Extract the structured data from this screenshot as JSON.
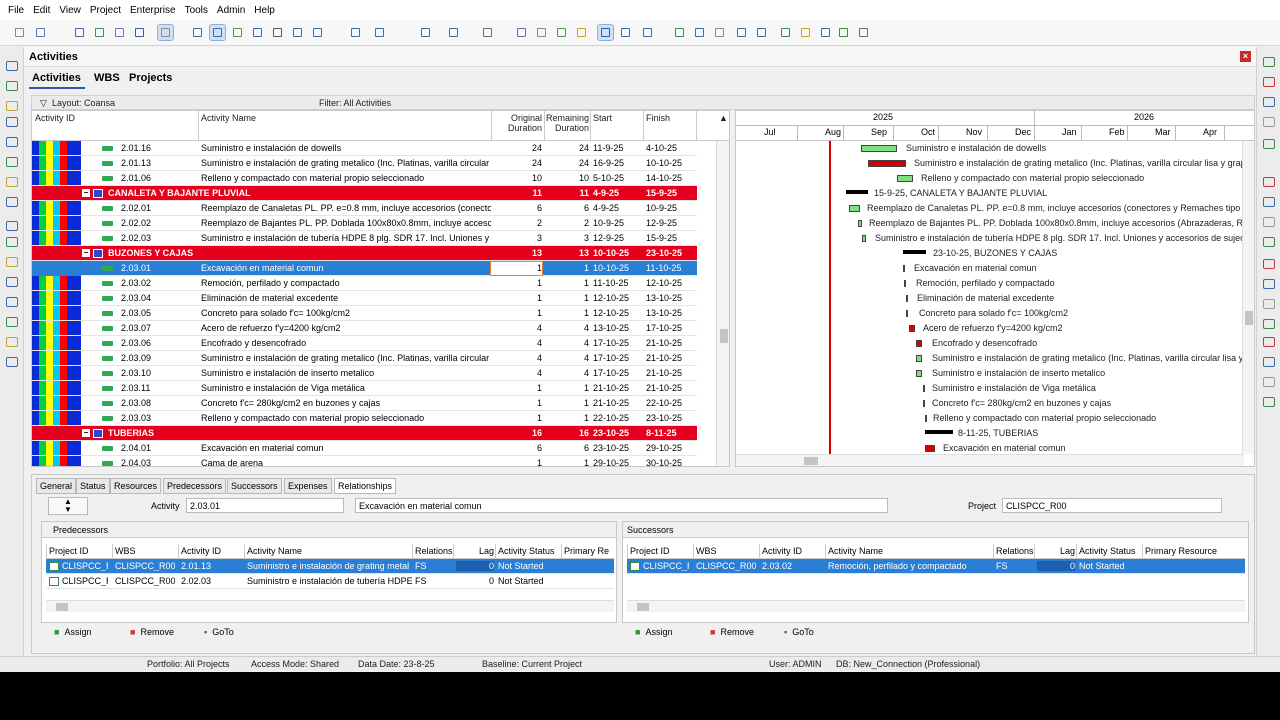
{
  "menu": [
    "File",
    "Edit",
    "View",
    "Project",
    "Enterprise",
    "Tools",
    "Admin",
    "Help"
  ],
  "panel_title": "Activities",
  "tabs": [
    "Activities",
    "WBS",
    "Projects"
  ],
  "layout_label": "Layout: Coansa",
  "filter_label": "Filter: All Activities",
  "grid": {
    "columns": {
      "id": "Activity ID",
      "name": "Activity Name",
      "od": "Original\nDuration",
      "rd": "Remaining\nDuration",
      "start": "Start",
      "finish": "Finish"
    },
    "rows": [
      {
        "type": "act",
        "id": "2.01.16",
        "name": "Suministro e instalación de dowells",
        "od": "24",
        "rd": "24",
        "start": "11-9-25",
        "finish": "4-10-25"
      },
      {
        "type": "act",
        "id": "2.01.13",
        "name": "Suministro e instalación de grating metalico (Inc. Platinas, varilla circular li",
        "od": "24",
        "rd": "24",
        "start": "16-9-25",
        "finish": "10-10-25"
      },
      {
        "type": "act",
        "id": "2.01.06",
        "name": "Relleno y compactado con material propio seleccionado",
        "od": "10",
        "rd": "10",
        "start": "5-10-25",
        "finish": "14-10-25"
      },
      {
        "type": "wbs",
        "id": "CANALETA Y BAJANTE PLUVIAL",
        "name": "",
        "od": "11",
        "rd": "11",
        "start": "4-9-25",
        "finish": "15-9-25"
      },
      {
        "type": "act",
        "id": "2.02.01",
        "name": "Reemplazo de Canaletas PL. PP. e=0.8 mm, incluye accesorios (conector",
        "od": "6",
        "rd": "6",
        "start": "4-9-25",
        "finish": "10-9-25"
      },
      {
        "type": "act",
        "id": "2.02.02",
        "name": "Reemplazo de Bajantes PL. PP. Doblada 100x80x0.8mm, incluye accesc",
        "od": "2",
        "rd": "2",
        "start": "10-9-25",
        "finish": "12-9-25"
      },
      {
        "type": "act",
        "id": "2.02.03",
        "name": "Suministro e instalación de tubería HDPE 8 plg. SDR 17. Incl. Uniones y",
        "od": "3",
        "rd": "3",
        "start": "12-9-25",
        "finish": "15-9-25"
      },
      {
        "type": "wbs",
        "id": "BUZONES Y CAJAS",
        "name": "",
        "od": "13",
        "rd": "13",
        "start": "10-10-25",
        "finish": "23-10-25"
      },
      {
        "type": "sel",
        "id": "2.03.01",
        "name": "Excavación en material comun",
        "od": "1",
        "rd": "1",
        "start": "10-10-25",
        "finish": "11-10-25"
      },
      {
        "type": "act",
        "id": "2.03.02",
        "name": "Remoción, perfilado y compactado",
        "od": "1",
        "rd": "1",
        "start": "11-10-25",
        "finish": "12-10-25"
      },
      {
        "type": "act",
        "id": "2.03.04",
        "name": "Eliminación de material excedente",
        "od": "1",
        "rd": "1",
        "start": "12-10-25",
        "finish": "13-10-25"
      },
      {
        "type": "act",
        "id": "2.03.05",
        "name": "Concreto para solado f'c= 100kg/cm2",
        "od": "1",
        "rd": "1",
        "start": "12-10-25",
        "finish": "13-10-25"
      },
      {
        "type": "act",
        "id": "2.03.07",
        "name": "Acero de refuerzo f'y=4200 kg/cm2",
        "od": "4",
        "rd": "4",
        "start": "13-10-25",
        "finish": "17-10-25"
      },
      {
        "type": "act",
        "id": "2.03.06",
        "name": "Encofrado y desencofrado",
        "od": "4",
        "rd": "4",
        "start": "17-10-25",
        "finish": "21-10-25"
      },
      {
        "type": "act",
        "id": "2.03.09",
        "name": "Suministro e instalación de grating metalico (Inc. Platinas, varilla circular li",
        "od": "4",
        "rd": "4",
        "start": "17-10-25",
        "finish": "21-10-25"
      },
      {
        "type": "act",
        "id": "2.03.10",
        "name": "Suministro e instalación de inserto metalico",
        "od": "4",
        "rd": "4",
        "start": "17-10-25",
        "finish": "21-10-25"
      },
      {
        "type": "act",
        "id": "2.03.11",
        "name": "Suministro e instalación de Viga metálica",
        "od": "1",
        "rd": "1",
        "start": "21-10-25",
        "finish": "21-10-25"
      },
      {
        "type": "act",
        "id": "2.03.08",
        "name": "Concreto f'c= 280kg/cm2 en buzones y cajas",
        "od": "1",
        "rd": "1",
        "start": "21-10-25",
        "finish": "22-10-25"
      },
      {
        "type": "act",
        "id": "2.03.03",
        "name": "Relleno y compactado con material propio seleccionado",
        "od": "1",
        "rd": "1",
        "start": "22-10-25",
        "finish": "23-10-25"
      },
      {
        "type": "wbs",
        "id": "TUBERIAS",
        "name": "",
        "od": "16",
        "rd": "16",
        "start": "23-10-25",
        "finish": "8-11-25"
      },
      {
        "type": "act",
        "id": "2.04.01",
        "name": "Excavación en material comun",
        "od": "6",
        "rd": "6",
        "start": "23-10-25",
        "finish": "29-10-25"
      },
      {
        "type": "act",
        "id": "2.04.03",
        "name": "Cama de arena",
        "od": "1",
        "rd": "1",
        "start": "29-10-25",
        "finish": "30-10-25"
      }
    ]
  },
  "gantt": {
    "years": [
      "2025",
      "2026"
    ],
    "months": [
      "Jul",
      "Aug",
      "Sep",
      "Oct",
      "Nov",
      "Dec",
      "Jan",
      "Feb",
      "Mar",
      "Apr"
    ],
    "labels": [
      "Suministro e instalación de dowells",
      "Suministro e instalación de grating metalico (Inc. Platinas, varilla circular lisa y grapa",
      "Relleno y compactado con material propio seleccionado",
      "15-9-25, CANALETA Y BAJANTE PLUVIAL",
      "Reemplazo de Canaletas PL. PP. e=0.8 mm, incluye accesorios (conectores y Remaches tipo P",
      "Reemplazo de Bajantes PL. PP. Doblada 100x80x0.8mm, incluye accesorios (Abrazaderas, Re",
      "Suministro e instalación de tubería HDPE 8 plg. SDR 17. Incl. Uniones y accesorios de sujec",
      "23-10-25, BUZONES Y CAJAS",
      "Excavación en material comun",
      "Remoción, perfilado y compactado",
      "Eliminación de material excedente",
      "Concreto para solado f'c= 100kg/cm2",
      "Acero de refuerzo f'y=4200 kg/cm2",
      "Encofrado y desencofrado",
      "Suministro e instalación de grating metalico (Inc. Platinas, varilla circular lisa y g",
      "Suministro e instalación de inserto metalico",
      "Suministro e instalación de Viga metálica",
      "Concreto f'c= 280kg/cm2 en buzones y cajas",
      "Relleno y compactado con material propio seleccionado",
      "8-11-25, TUBERIAS",
      "Excavación en material comun"
    ]
  },
  "detail": {
    "tabs": [
      "General",
      "Status",
      "Resources",
      "Predecessors",
      "Successors",
      "Expenses",
      "Relationships"
    ],
    "activity_label": "Activity",
    "activity_id": "2.03.01",
    "activity_name": "Excavación en material comun",
    "project_label": "Project",
    "project_value": "CLISPCC_R00",
    "pred_title": "Predecessors",
    "succ_title": "Successors",
    "pred_cols": [
      "Project ID",
      "WBS",
      "Activity ID",
      "Activity Name",
      "Relations",
      "Lag",
      "Activity Status",
      "Primary Re"
    ],
    "succ_cols": [
      "Project ID",
      "WBS",
      "Activity ID",
      "Activity Name",
      "Relations",
      "Lag",
      "Activity Status",
      "Primary Resource"
    ],
    "pred_rows": [
      [
        "CLISPCC_R",
        "CLISPCC_R00.'",
        "2.01.13",
        "Suministro e instalación de grating metal",
        "FS",
        "0",
        "Not Started",
        ""
      ],
      [
        "CLISPCC_R",
        "CLISPCC_R00.'",
        "2.02.03",
        "Suministro e instalación de tubería HDPE",
        "FS",
        "0",
        "Not Started",
        ""
      ]
    ],
    "succ_rows": [
      [
        "CLISPCC_R",
        "CLISPCC_R00.'",
        "2.03.02",
        "Remoción, perfilado y compactado",
        "FS",
        "0",
        "Not Started",
        ""
      ]
    ],
    "buttons": [
      "Assign",
      "Remove",
      "GoTo"
    ]
  },
  "status": [
    "Portfolio: All Projects",
    "Access Mode: Shared",
    "Data Date: 23-8-25",
    "Baseline: Current Project",
    "User: ADMIN",
    "DB: New_Connection (Professional)"
  ],
  "colors": {
    "wbs_red": "#e6001e",
    "selection": "#2a7fd4",
    "bar_green": "#7fe07f",
    "crit_red": "#d40000"
  }
}
